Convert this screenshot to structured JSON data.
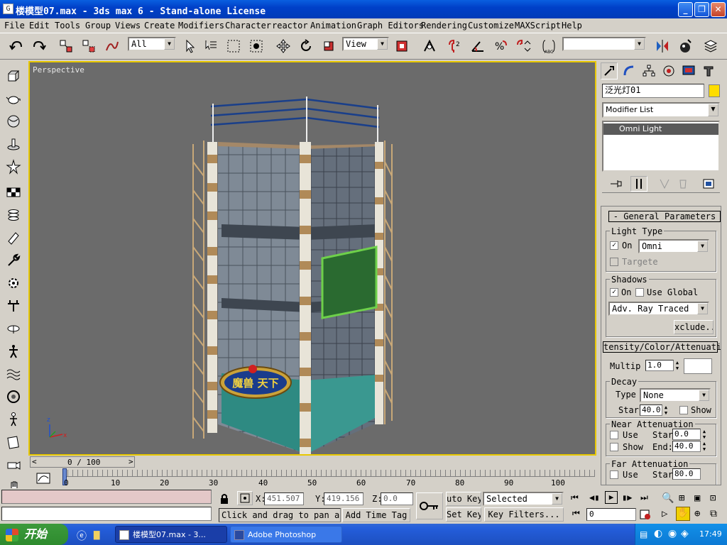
{
  "window": {
    "title": "楼模型07.max - 3ds max 6 - Stand-alone License",
    "min_label": "_",
    "max_label": "❐",
    "close_label": "✕"
  },
  "menu": [
    "File",
    "Edit",
    "Tools",
    "Group",
    "Views",
    "Create",
    "Modifiers",
    "Character",
    "reactor",
    "Animation",
    "Graph Editors",
    "Rendering",
    "Customize",
    "MAXScript",
    "Help"
  ],
  "toolbar": {
    "selection_filter": "All",
    "ref_coord": "View",
    "named_selection": ""
  },
  "viewport": {
    "label": "Perspective",
    "sign_text": "魔兽 天下"
  },
  "timeslider": {
    "label": "0 / 100",
    "left_arrow": "<",
    "right_arrow": ">"
  },
  "track": {
    "ticks": [
      "0",
      "10",
      "20",
      "30",
      "40",
      "50",
      "60",
      "70",
      "80",
      "90",
      "100"
    ]
  },
  "command_panel": {
    "object_name": "泛光灯01",
    "modifier_list": "Modifier List",
    "stack_item": "Omni Light",
    "general_parameters": "- General Parameters",
    "light_type_label": "Light Type",
    "on_label": "On",
    "on_checked": true,
    "light_type_value": "Omni",
    "targeted_label": "Targete",
    "shadows_label": "Shadows",
    "shadows_on_label": "On",
    "shadows_on_checked": true,
    "use_global_label": "Use Global",
    "shadow_type": "Adv. Ray Traced",
    "exclude_label": "xclude...",
    "intensity_rollout": "tensity/Color/Attenuati",
    "multiplier_label": "Multip",
    "multiplier_value": "1.0",
    "light_color": "#ffffff",
    "decay_label": "Decay",
    "decay_type_label": "Type",
    "decay_type_value": "None",
    "decay_start_label": "Star",
    "decay_start_value": "40.0",
    "show_label": "Show",
    "near_atten_label": "Near Attenuation",
    "near_use_label": "Use",
    "near_start_label": "Star",
    "near_start_value": "0.0",
    "near_show_label": "Show",
    "near_end_label": "End:",
    "near_end_value": "40.0",
    "far_atten_label": "Far Attenuation",
    "far_use_label": "Use",
    "far_start_label": "Star",
    "far_start_value": "80.0",
    "color_swatch": "#ffdd00"
  },
  "status": {
    "x_label": "X:",
    "x_value": "451.507",
    "y_label": "Y:",
    "y_value": "419.156",
    "z_label": "Z:",
    "z_value": "0.0",
    "prompt": "Click and drag to pan a",
    "add_time_tag": "Add Time Tag",
    "auto_key": "uto Key",
    "set_key": "Set Key",
    "selected": "Selected",
    "key_filters": "Key Filters...",
    "frame": "0"
  },
  "taskbar": {
    "start": "开始",
    "tasks": [
      "楼模型07.max - 3...",
      "Adobe Photoshop"
    ],
    "clock": "17:49"
  },
  "colors": {
    "viewport_bg": "#6b6b6b",
    "active_border": "#e8c800",
    "titlebar": "#0a5fe0"
  }
}
